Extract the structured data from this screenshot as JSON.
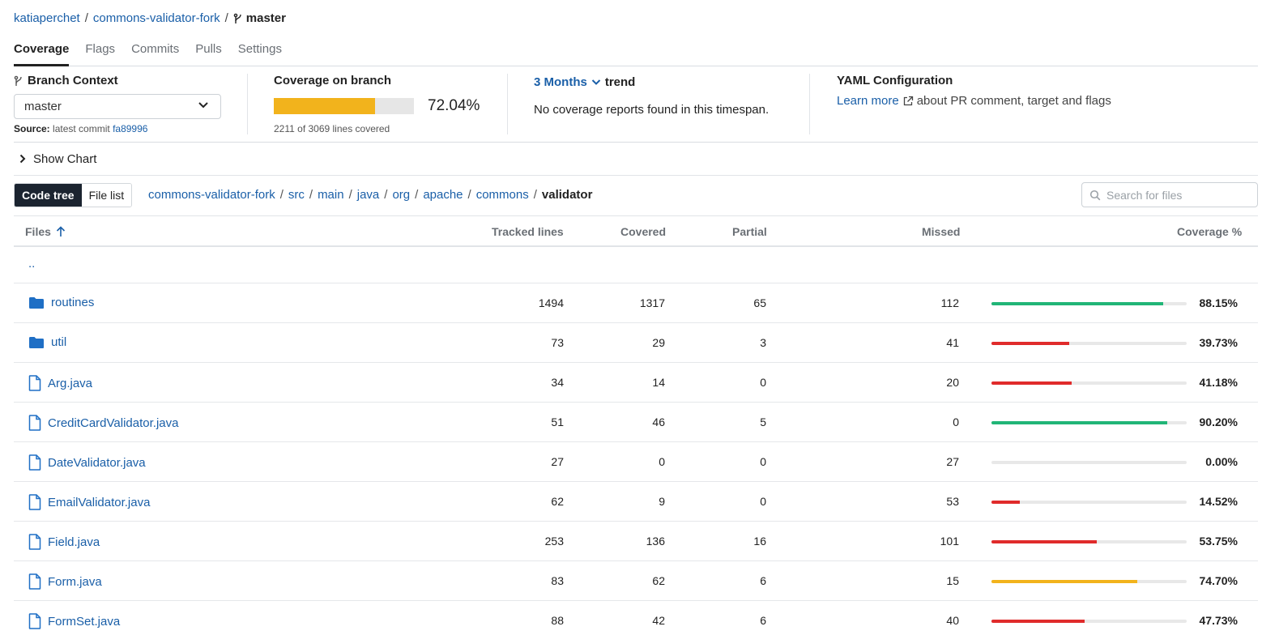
{
  "breadcrumb": {
    "owner": "katiaperchet",
    "repo": "commons-validator-fork",
    "branch": "master"
  },
  "tabs": [
    "Coverage",
    "Flags",
    "Commits",
    "Pulls",
    "Settings"
  ],
  "branch_context": {
    "title": "Branch Context",
    "selected": "master",
    "source_label": "Source:",
    "source_text": "latest commit",
    "commit": "fa89996"
  },
  "coverage_on_branch": {
    "title": "Coverage on branch",
    "percent_text": "72.04%",
    "percent_value": 72.04,
    "lines_text": "2211 of 3069 lines covered",
    "bar_color": "#f2b31c"
  },
  "trend": {
    "range": "3 Months",
    "label": "trend",
    "message": "No coverage reports found in this timespan."
  },
  "yaml": {
    "title": "YAML Configuration",
    "link": "Learn more",
    "rest": "about PR comment, target and flags"
  },
  "show_chart": "Show Chart",
  "view_toggle": {
    "active": "Code tree",
    "inactive": "File list"
  },
  "path": {
    "segments": [
      "commons-validator-fork",
      "src",
      "main",
      "java",
      "org",
      "apache",
      "commons"
    ],
    "current": "validator"
  },
  "search": {
    "placeholder": "Search for files"
  },
  "table": {
    "headers": {
      "files": "Files",
      "tracked": "Tracked lines",
      "covered": "Covered",
      "partial": "Partial",
      "missed": "Missed",
      "coverage": "Coverage %"
    },
    "parent_link": "..",
    "rows": [
      {
        "type": "folder",
        "name": "routines",
        "tracked": "1494",
        "covered": "1317",
        "partial": "65",
        "missed": "112",
        "pct": "88.15%",
        "value": 88.15,
        "color": "#21b577"
      },
      {
        "type": "folder",
        "name": "util",
        "tracked": "73",
        "covered": "29",
        "partial": "3",
        "missed": "41",
        "pct": "39.73%",
        "value": 39.73,
        "color": "#e02b2b"
      },
      {
        "type": "file",
        "name": "Arg.java",
        "tracked": "34",
        "covered": "14",
        "partial": "0",
        "missed": "20",
        "pct": "41.18%",
        "value": 41.18,
        "color": "#e02b2b"
      },
      {
        "type": "file",
        "name": "CreditCardValidator.java",
        "tracked": "51",
        "covered": "46",
        "partial": "5",
        "missed": "0",
        "pct": "90.20%",
        "value": 90.2,
        "color": "#21b577"
      },
      {
        "type": "file",
        "name": "DateValidator.java",
        "tracked": "27",
        "covered": "0",
        "partial": "0",
        "missed": "27",
        "pct": "0.00%",
        "value": 0,
        "color": "#e02b2b"
      },
      {
        "type": "file",
        "name": "EmailValidator.java",
        "tracked": "62",
        "covered": "9",
        "partial": "0",
        "missed": "53",
        "pct": "14.52%",
        "value": 14.52,
        "color": "#e02b2b"
      },
      {
        "type": "file",
        "name": "Field.java",
        "tracked": "253",
        "covered": "136",
        "partial": "16",
        "missed": "101",
        "pct": "53.75%",
        "value": 53.75,
        "color": "#e02b2b"
      },
      {
        "type": "file",
        "name": "Form.java",
        "tracked": "83",
        "covered": "62",
        "partial": "6",
        "missed": "15",
        "pct": "74.70%",
        "value": 74.7,
        "color": "#f2b31c"
      },
      {
        "type": "file",
        "name": "FormSet.java",
        "tracked": "88",
        "covered": "42",
        "partial": "6",
        "missed": "40",
        "pct": "47.73%",
        "value": 47.73,
        "color": "#e02b2b"
      }
    ]
  }
}
